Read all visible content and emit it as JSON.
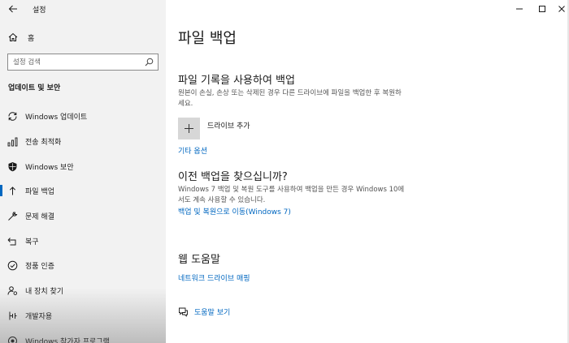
{
  "window": {
    "title": "설정",
    "back_icon": "back-arrow-icon",
    "controls": [
      "minimize-icon",
      "maximize-icon",
      "close-icon"
    ]
  },
  "sidebar": {
    "home_label": "홈",
    "search_placeholder": "설정 검색",
    "section_title": "업데이트 및 보안",
    "items": [
      {
        "label": "Windows 업데이트",
        "icon": "sync-icon",
        "active": false
      },
      {
        "label": "전송 최적화",
        "icon": "delivery-optimization-icon",
        "active": false
      },
      {
        "label": "Windows 보안",
        "icon": "shield-icon",
        "active": false
      },
      {
        "label": "파일 백업",
        "icon": "backup-arrow-icon",
        "active": true
      },
      {
        "label": "문제 해결",
        "icon": "wrench-icon",
        "active": false
      },
      {
        "label": "복구",
        "icon": "recovery-icon",
        "active": false
      },
      {
        "label": "정품 인증",
        "icon": "check-circle-icon",
        "active": false
      },
      {
        "label": "내 장치 찾기",
        "icon": "person-location-icon",
        "active": false
      },
      {
        "label": "개발자용",
        "icon": "developer-icon",
        "active": false
      },
      {
        "label": "Windows 참가자 프로그램",
        "icon": "insider-icon",
        "active": false
      }
    ]
  },
  "main": {
    "page_title": "파일 백업",
    "file_history": {
      "heading": "파일 기록을 사용하여 백업",
      "description": "원본이 손실, 손상 또는 삭제된 경우 다른 드라이브에 파일을 백업한 후 복원하세요.",
      "add_drive_label": "드라이브 추가",
      "more_options_link": "기타 옵션"
    },
    "older_backup": {
      "heading": "이전 백업을 찾으십니까?",
      "description": "Windows 7 백업 및 복원 도구를 사용하여 백업을 만든 경우 Windows 10에서도 계속 사용할 수 있습니다.",
      "link": "백업 및 복원으로 이동(Windows 7)"
    },
    "web_help": {
      "heading": "웹 도움말",
      "link": "네트워크 드라이브 매핑"
    },
    "get_help_link": "도움말 보기"
  }
}
